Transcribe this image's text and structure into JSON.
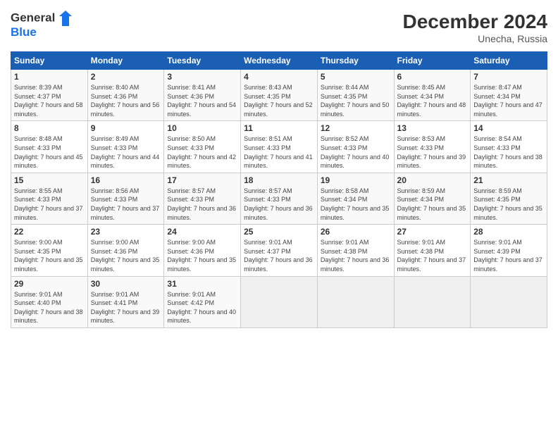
{
  "header": {
    "logo_line1": "General",
    "logo_line2": "Blue",
    "month_year": "December 2024",
    "location": "Unecha, Russia"
  },
  "weekdays": [
    "Sunday",
    "Monday",
    "Tuesday",
    "Wednesday",
    "Thursday",
    "Friday",
    "Saturday"
  ],
  "weeks": [
    [
      {
        "day": "1",
        "sunrise": "Sunrise: 8:39 AM",
        "sunset": "Sunset: 4:37 PM",
        "daylight": "Daylight: 7 hours and 58 minutes."
      },
      {
        "day": "2",
        "sunrise": "Sunrise: 8:40 AM",
        "sunset": "Sunset: 4:36 PM",
        "daylight": "Daylight: 7 hours and 56 minutes."
      },
      {
        "day": "3",
        "sunrise": "Sunrise: 8:41 AM",
        "sunset": "Sunset: 4:36 PM",
        "daylight": "Daylight: 7 hours and 54 minutes."
      },
      {
        "day": "4",
        "sunrise": "Sunrise: 8:43 AM",
        "sunset": "Sunset: 4:35 PM",
        "daylight": "Daylight: 7 hours and 52 minutes."
      },
      {
        "day": "5",
        "sunrise": "Sunrise: 8:44 AM",
        "sunset": "Sunset: 4:35 PM",
        "daylight": "Daylight: 7 hours and 50 minutes."
      },
      {
        "day": "6",
        "sunrise": "Sunrise: 8:45 AM",
        "sunset": "Sunset: 4:34 PM",
        "daylight": "Daylight: 7 hours and 48 minutes."
      },
      {
        "day": "7",
        "sunrise": "Sunrise: 8:47 AM",
        "sunset": "Sunset: 4:34 PM",
        "daylight": "Daylight: 7 hours and 47 minutes."
      }
    ],
    [
      {
        "day": "8",
        "sunrise": "Sunrise: 8:48 AM",
        "sunset": "Sunset: 4:33 PM",
        "daylight": "Daylight: 7 hours and 45 minutes."
      },
      {
        "day": "9",
        "sunrise": "Sunrise: 8:49 AM",
        "sunset": "Sunset: 4:33 PM",
        "daylight": "Daylight: 7 hours and 44 minutes."
      },
      {
        "day": "10",
        "sunrise": "Sunrise: 8:50 AM",
        "sunset": "Sunset: 4:33 PM",
        "daylight": "Daylight: 7 hours and 42 minutes."
      },
      {
        "day": "11",
        "sunrise": "Sunrise: 8:51 AM",
        "sunset": "Sunset: 4:33 PM",
        "daylight": "Daylight: 7 hours and 41 minutes."
      },
      {
        "day": "12",
        "sunrise": "Sunrise: 8:52 AM",
        "sunset": "Sunset: 4:33 PM",
        "daylight": "Daylight: 7 hours and 40 minutes."
      },
      {
        "day": "13",
        "sunrise": "Sunrise: 8:53 AM",
        "sunset": "Sunset: 4:33 PM",
        "daylight": "Daylight: 7 hours and 39 minutes."
      },
      {
        "day": "14",
        "sunrise": "Sunrise: 8:54 AM",
        "sunset": "Sunset: 4:33 PM",
        "daylight": "Daylight: 7 hours and 38 minutes."
      }
    ],
    [
      {
        "day": "15",
        "sunrise": "Sunrise: 8:55 AM",
        "sunset": "Sunset: 4:33 PM",
        "daylight": "Daylight: 7 hours and 37 minutes."
      },
      {
        "day": "16",
        "sunrise": "Sunrise: 8:56 AM",
        "sunset": "Sunset: 4:33 PM",
        "daylight": "Daylight: 7 hours and 37 minutes."
      },
      {
        "day": "17",
        "sunrise": "Sunrise: 8:57 AM",
        "sunset": "Sunset: 4:33 PM",
        "daylight": "Daylight: 7 hours and 36 minutes."
      },
      {
        "day": "18",
        "sunrise": "Sunrise: 8:57 AM",
        "sunset": "Sunset: 4:33 PM",
        "daylight": "Daylight: 7 hours and 36 minutes."
      },
      {
        "day": "19",
        "sunrise": "Sunrise: 8:58 AM",
        "sunset": "Sunset: 4:34 PM",
        "daylight": "Daylight: 7 hours and 35 minutes."
      },
      {
        "day": "20",
        "sunrise": "Sunrise: 8:59 AM",
        "sunset": "Sunset: 4:34 PM",
        "daylight": "Daylight: 7 hours and 35 minutes."
      },
      {
        "day": "21",
        "sunrise": "Sunrise: 8:59 AM",
        "sunset": "Sunset: 4:35 PM",
        "daylight": "Daylight: 7 hours and 35 minutes."
      }
    ],
    [
      {
        "day": "22",
        "sunrise": "Sunrise: 9:00 AM",
        "sunset": "Sunset: 4:35 PM",
        "daylight": "Daylight: 7 hours and 35 minutes."
      },
      {
        "day": "23",
        "sunrise": "Sunrise: 9:00 AM",
        "sunset": "Sunset: 4:36 PM",
        "daylight": "Daylight: 7 hours and 35 minutes."
      },
      {
        "day": "24",
        "sunrise": "Sunrise: 9:00 AM",
        "sunset": "Sunset: 4:36 PM",
        "daylight": "Daylight: 7 hours and 35 minutes."
      },
      {
        "day": "25",
        "sunrise": "Sunrise: 9:01 AM",
        "sunset": "Sunset: 4:37 PM",
        "daylight": "Daylight: 7 hours and 36 minutes."
      },
      {
        "day": "26",
        "sunrise": "Sunrise: 9:01 AM",
        "sunset": "Sunset: 4:38 PM",
        "daylight": "Daylight: 7 hours and 36 minutes."
      },
      {
        "day": "27",
        "sunrise": "Sunrise: 9:01 AM",
        "sunset": "Sunset: 4:38 PM",
        "daylight": "Daylight: 7 hours and 37 minutes."
      },
      {
        "day": "28",
        "sunrise": "Sunrise: 9:01 AM",
        "sunset": "Sunset: 4:39 PM",
        "daylight": "Daylight: 7 hours and 37 minutes."
      }
    ],
    [
      {
        "day": "29",
        "sunrise": "Sunrise: 9:01 AM",
        "sunset": "Sunset: 4:40 PM",
        "daylight": "Daylight: 7 hours and 38 minutes."
      },
      {
        "day": "30",
        "sunrise": "Sunrise: 9:01 AM",
        "sunset": "Sunset: 4:41 PM",
        "daylight": "Daylight: 7 hours and 39 minutes."
      },
      {
        "day": "31",
        "sunrise": "Sunrise: 9:01 AM",
        "sunset": "Sunset: 4:42 PM",
        "daylight": "Daylight: 7 hours and 40 minutes."
      },
      null,
      null,
      null,
      null
    ]
  ]
}
